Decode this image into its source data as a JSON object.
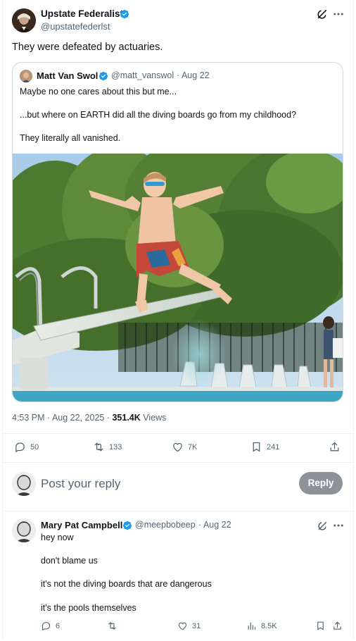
{
  "main_tweet": {
    "author_name": "Upstate Federalist",
    "author_handle": "@upstatefederlst",
    "text": "They were defeated by actuaries."
  },
  "quoted_tweet": {
    "author_name": "Matt Van Swol",
    "author_handle": "@matt_vanswol",
    "date": "· Aug 22",
    "lines": [
      "Maybe no one cares about this but me...",
      "...but where on EARTH did all the diving boards go from my childhood?",
      "They literally all vanished."
    ]
  },
  "meta": {
    "time": "4:53 PM · Aug 22, 2025 ·",
    "views_count": "351.4K",
    "views_label": "Views"
  },
  "actions": {
    "replies": "50",
    "reposts": "133",
    "likes": "7K",
    "bookmarks": "241"
  },
  "composer": {
    "placeholder": "Post your reply",
    "button": "Reply"
  },
  "reply": {
    "author_name": "Mary Pat Campbell",
    "author_handle": "@meepbobeep",
    "date": "· Aug 22",
    "lines": [
      "hey now",
      "don't blame us",
      "it's not the diving boards that are dangerous",
      "it's the pools themselves"
    ],
    "replies": "6",
    "likes": "31",
    "views": "8.5K"
  },
  "colors": {
    "verified": "#1d9bf0",
    "secondary_text": "#536471",
    "reply_button": "#8c9398"
  },
  "icons": [
    "verified-badge-icon",
    "grok-icon",
    "more-icon",
    "reply-icon",
    "repost-icon",
    "like-icon",
    "bookmark-icon",
    "share-icon",
    "views-icon"
  ]
}
